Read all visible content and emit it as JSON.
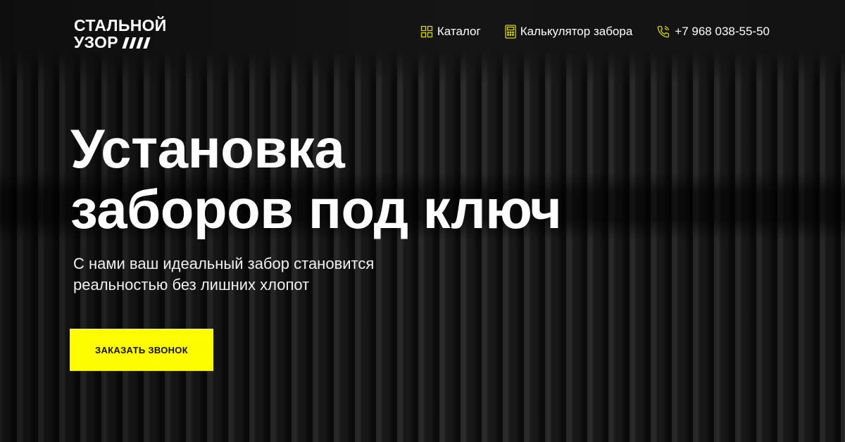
{
  "brand": {
    "logo_line1": "СТАЛЬНОЙ",
    "logo_line2": "УЗОР"
  },
  "nav": {
    "catalog": {
      "label": "Каталог",
      "icon": "grid-icon"
    },
    "calculator": {
      "label": "Калькулятор забора",
      "icon": "calculator-icon"
    },
    "phone": {
      "label": "+7 968 038-55-50",
      "icon": "phone-icon"
    }
  },
  "hero": {
    "title_line1": "Установка",
    "title_line2": "заборов под ключ",
    "subtitle_line1": "С нами ваш идеальный забор становится",
    "subtitle_line2": "реальностью без лишних хлопот",
    "cta_label": "ЗАКАЗАТЬ ЗВОНОК"
  },
  "colors": {
    "accent": "#fdfd00",
    "icon_accent": "#d4d400",
    "background": "#161616",
    "text": "#ffffff"
  }
}
